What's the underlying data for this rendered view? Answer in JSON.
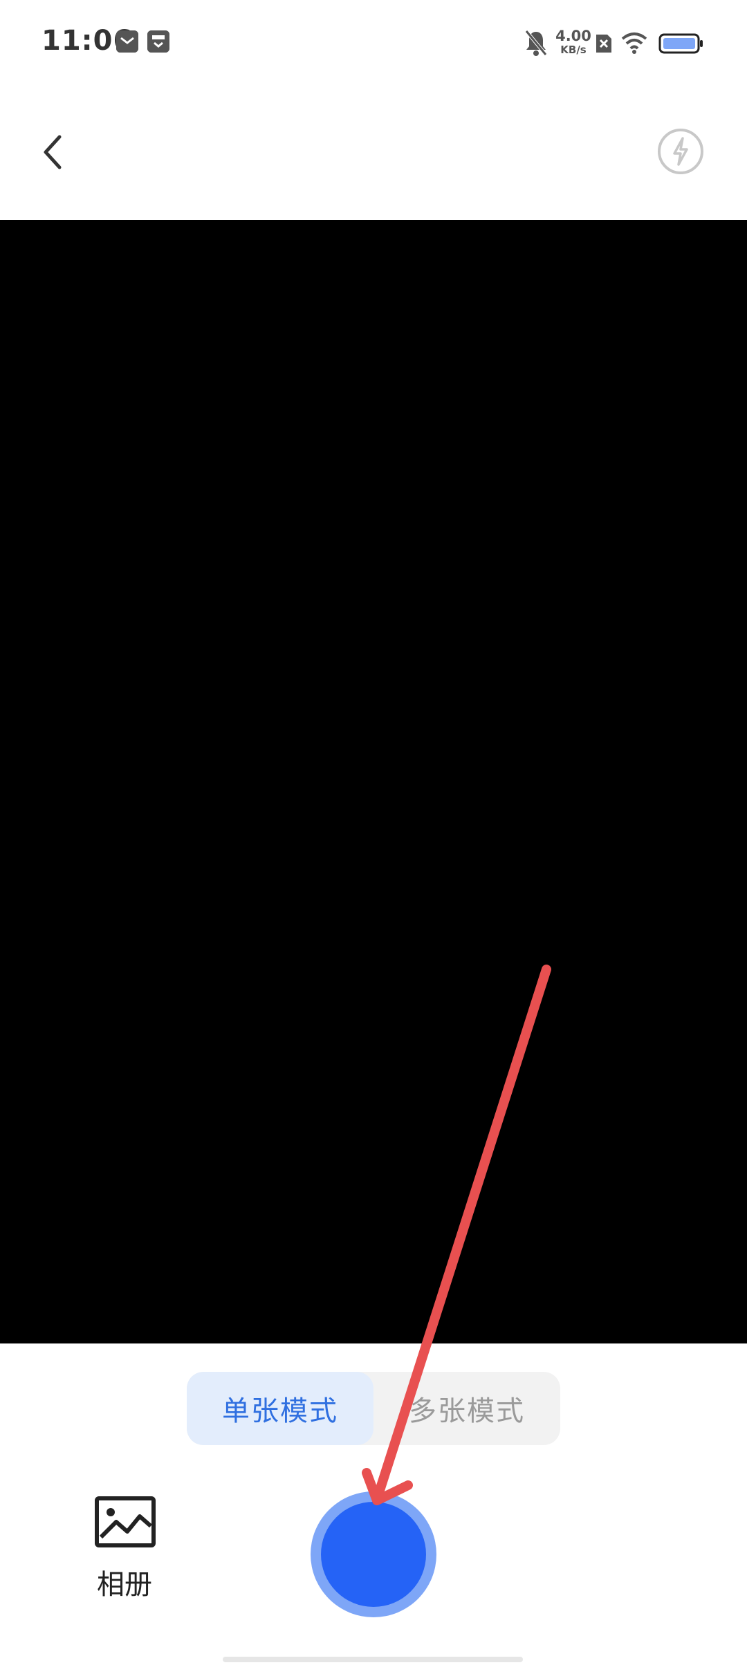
{
  "status_bar": {
    "time": "11:06",
    "net_speed_value": "4.00",
    "net_speed_unit": "KB/s",
    "icons": [
      "mail-notification-icon",
      "inbox-notification-icon",
      "bell-muted-icon",
      "sim-none-icon",
      "wifi-icon",
      "battery-icon"
    ]
  },
  "top_bar": {
    "back_icon": "chevron-left-icon",
    "flash_icon": "flash-off-icon"
  },
  "mode_switch": {
    "active_label": "单张模式",
    "inactive_label": "多张模式"
  },
  "bottom": {
    "album_label": "相册",
    "album_icon": "image-icon",
    "shutter_icon": "shutter-button"
  },
  "colors": {
    "accent": "#2563f6",
    "shutter_ring": "#7ea6f7",
    "active_tab_bg": "#e3edfc",
    "active_tab_text": "#2f6fe0",
    "annotation_arrow": "#e85050"
  }
}
